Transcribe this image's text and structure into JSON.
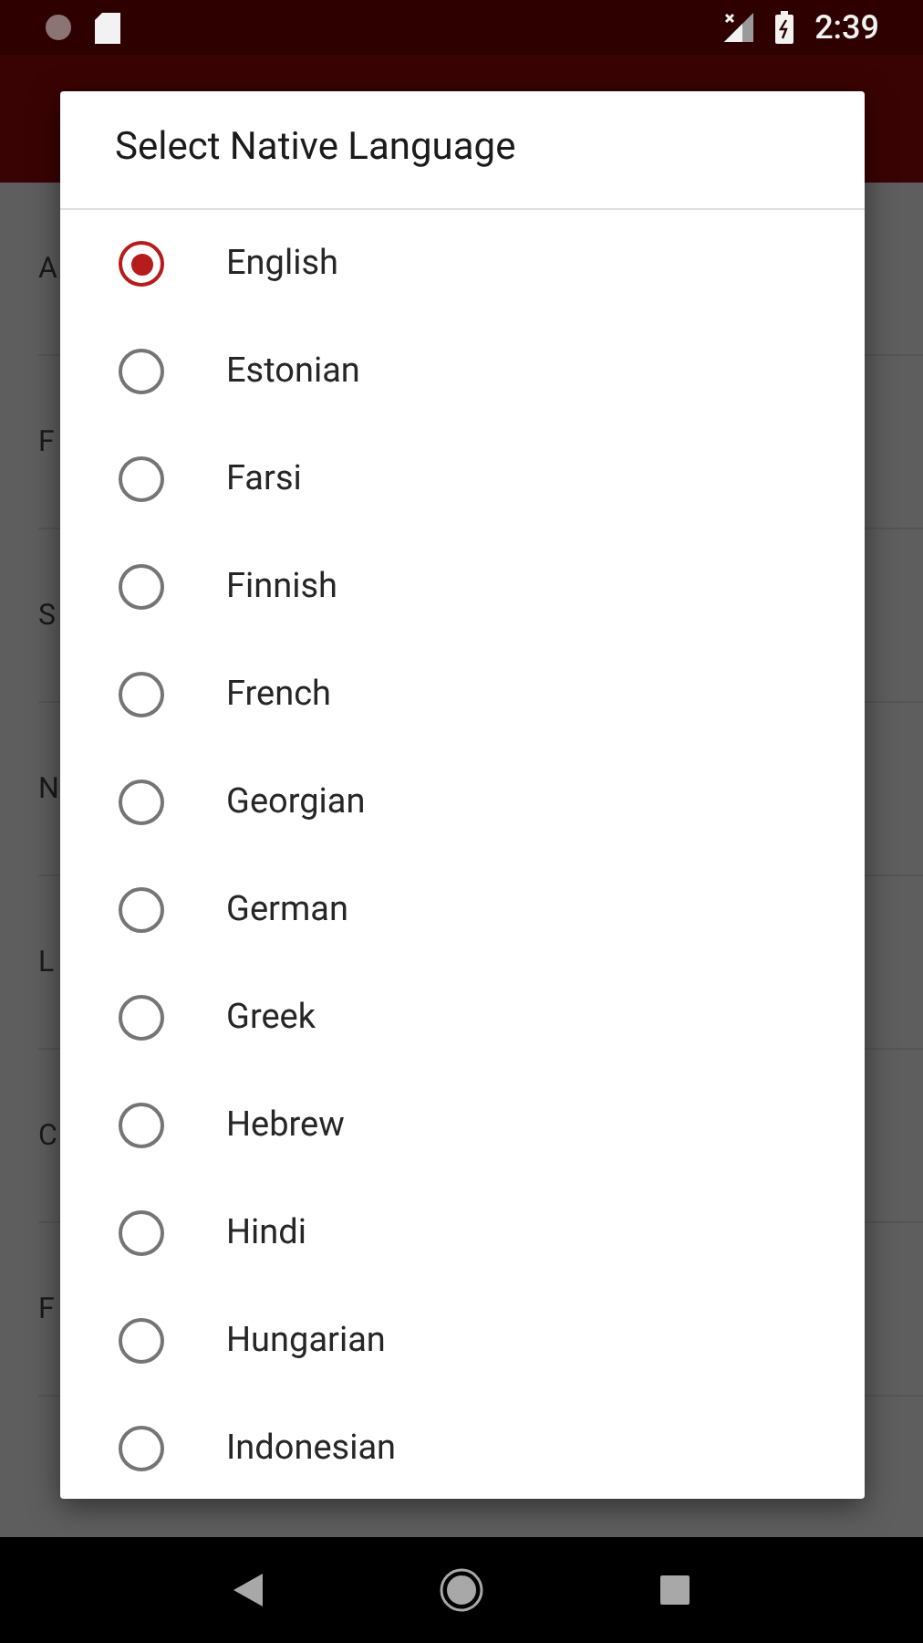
{
  "status_bar": {
    "time": "2:39"
  },
  "background_list": [
    "A",
    "F",
    "S",
    "N",
    "L",
    "C",
    "F"
  ],
  "dialog": {
    "title": "Select Native Language",
    "options": [
      {
        "label": "English",
        "selected": true
      },
      {
        "label": "Estonian",
        "selected": false
      },
      {
        "label": "Farsi",
        "selected": false
      },
      {
        "label": "Finnish",
        "selected": false
      },
      {
        "label": "French",
        "selected": false
      },
      {
        "label": "Georgian",
        "selected": false
      },
      {
        "label": "German",
        "selected": false
      },
      {
        "label": "Greek",
        "selected": false
      },
      {
        "label": "Hebrew",
        "selected": false
      },
      {
        "label": "Hindi",
        "selected": false
      },
      {
        "label": "Hungarian",
        "selected": false
      },
      {
        "label": "Indonesian",
        "selected": false
      }
    ]
  }
}
